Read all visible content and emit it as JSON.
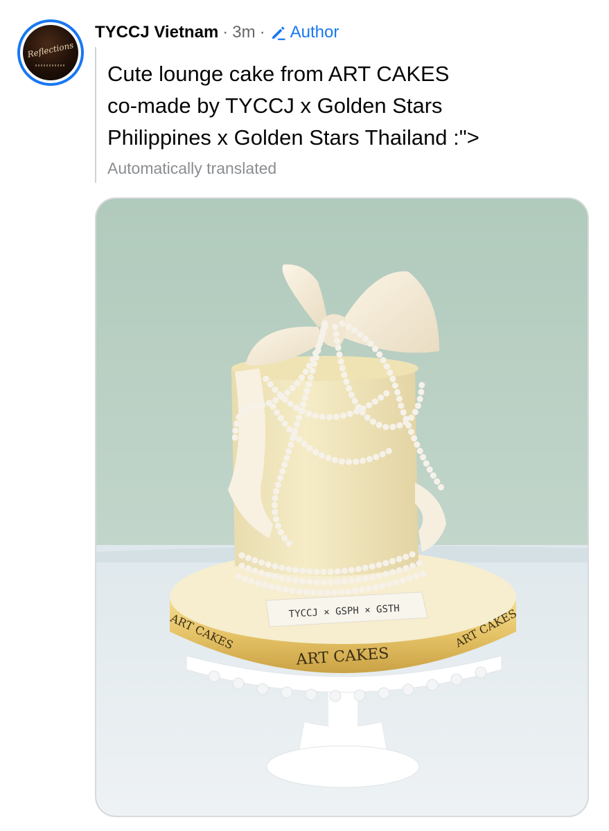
{
  "post": {
    "author": "TYCCJ Vietnam",
    "separator": "·",
    "time": "3m",
    "badge": "Author",
    "text_lines": [
      "Cute lounge cake from ART CAKES",
      "co-made by TYCCJ x Golden Stars",
      "Philippines x Golden Stars Thailand :\">"
    ],
    "translation_note": "Automatically translated"
  },
  "avatar": {
    "label": "Reflections"
  },
  "photo": {
    "ribbon_brand": "ART CAKES",
    "tag_text": "TYCCJ × GSPH × GSTH"
  },
  "colors": {
    "accent": "#1877f2",
    "photo_background": "#b2cbbd",
    "cake_body": "#f1e6bd"
  },
  "icons": {
    "author_badge": "pencil-icon"
  }
}
